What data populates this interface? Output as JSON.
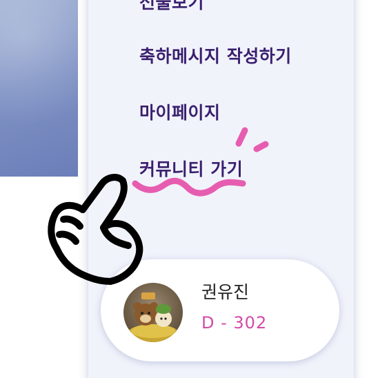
{
  "menu": {
    "items": [
      {
        "label": "선물보기"
      },
      {
        "label": "축하메시지 작성하기"
      },
      {
        "label": "마이페이지"
      },
      {
        "label": "커뮤니티 가기"
      }
    ]
  },
  "profile": {
    "name": "권유진",
    "dday": "D - 302"
  },
  "colors": {
    "menu_text": "#3a1f6e",
    "dday": "#d44aa6",
    "highlight": "#e65db0",
    "panel": "#f1f3fb"
  },
  "icons": {
    "pointer_hand": "hand-pointer-icon",
    "highlight_mark": "squiggle-underline-icon"
  }
}
